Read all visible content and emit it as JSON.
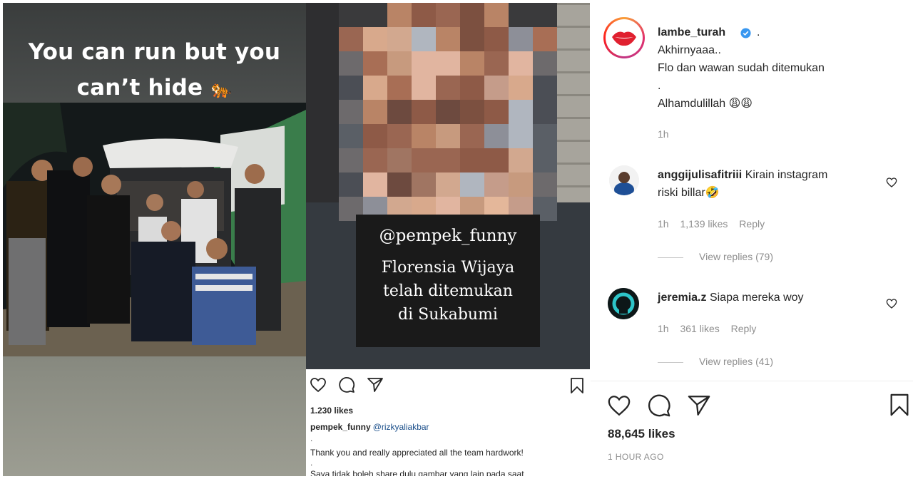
{
  "story": {
    "caption_line1": "You can run but you",
    "caption_line2": "can’t hide",
    "caption_emoji": "🐅"
  },
  "post": {
    "overlay_handle": "@pempek_funny",
    "overlay_lines": [
      "Florensia Wijaya",
      "telah ditemukan",
      "di Sukabumi"
    ],
    "likes": "1.230 likes",
    "caption_user": "pempek_funny",
    "caption_tag": "@rizkyaliakbar",
    "caption_dot": ".",
    "caption_text": "Thank you and really appreciated all the team hardwork!",
    "caption_dot2": ".",
    "caption_cut": "Saya tidak boleh share dulu gambar yang lain pada saat"
  },
  "comments": {
    "op": {
      "username": "lambe_turah",
      "after_badge": ".",
      "lines": [
        "Akhirnyaaa..",
        "Flo dan wawan sudah ditemukan",
        ".",
        "Alhamdulillah 😩😩"
      ],
      "time": "1h"
    },
    "items": [
      {
        "username": "anggijulisafitriii",
        "text_line1": "Kirain instagram",
        "text_line2": "riski billar🤣",
        "time": "1h",
        "likes": "1,139 likes",
        "reply": "Reply",
        "view_replies": "View replies (79)"
      },
      {
        "username": "jeremia.z",
        "text_line1": "Siapa mereka woy",
        "time": "1h",
        "likes": "361 likes",
        "reply": "Reply",
        "view_replies": "View replies (41)"
      }
    ],
    "likes_total": "88,645 likes",
    "time_ago": "1 HOUR AGO"
  },
  "icons": [
    "heart-icon",
    "comment-icon",
    "share-icon",
    "bookmark-icon",
    "verified-badge-icon"
  ],
  "colors": {
    "link_blue": "#1a4e8a",
    "verified_blue": "#3897f0",
    "muted_gray": "#8e8e8e",
    "text": "#262626"
  }
}
